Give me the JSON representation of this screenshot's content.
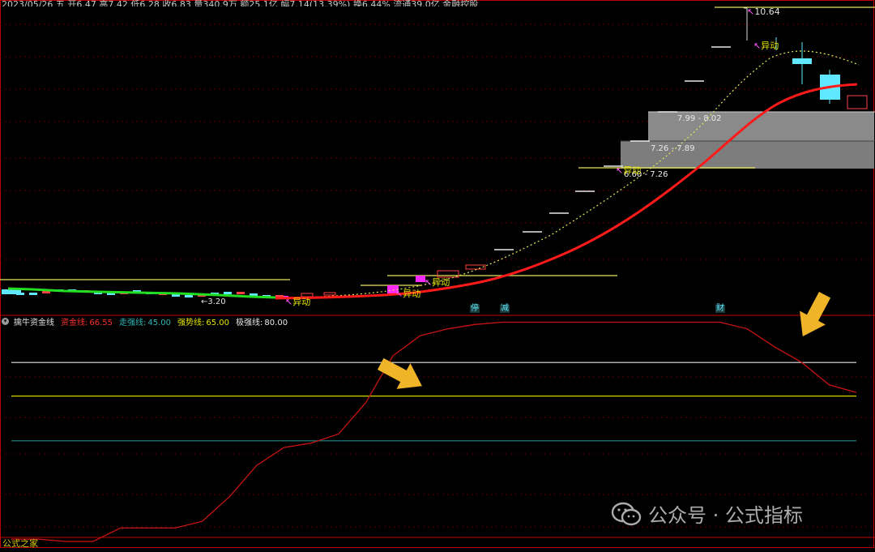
{
  "header": {
    "summary": "2023/05/26 五 开6.47 高7.42 低6.28 收6.83 量340.9万 额25.1亿 幅7.14(13.39%) 换6.44% 流通39.0亿 金融控股"
  },
  "colors": {
    "background": "#000000",
    "frame": "#c00000",
    "ma_red": "#ff1a1a",
    "ma_yellow": "#e6e65a",
    "zone_gray": "#8a8a8a",
    "candle_cyan": "#5fe8ff",
    "candle_magenta": "#ff2aff",
    "indicator_red": "#c81414",
    "line_white": "#e8e8e8",
    "line_yellow": "#d4d400",
    "line_teal": "#1f8a8a",
    "arrow": "#f0b428",
    "green": "#22dd22"
  },
  "main_chart": {
    "price_labels": {
      "high": "10.64",
      "low": "3.20"
    },
    "zones": [
      {
        "label": "7.99 - 8.02"
      },
      {
        "label": "7.26 - 7.89"
      },
      {
        "label": "6.60 - 7.26"
      }
    ],
    "signals": [
      "异动",
      "异动",
      "异动",
      "异动",
      "异动"
    ],
    "markers": [
      "停",
      "减",
      "财"
    ]
  },
  "indicator": {
    "title": "擒牛资金线",
    "legend": [
      {
        "name": "资金线:",
        "value": "66.55",
        "color": "#ff3030"
      },
      {
        "name": "走强线:",
        "value": "45.00",
        "color": "#2fb5b5"
      },
      {
        "name": "强势线:",
        "value": "65.00",
        "color": "#e6e600"
      },
      {
        "name": "极强线:",
        "value": "80.00",
        "color": "#e8e8e8"
      }
    ],
    "levels": {
      "extreme": 80,
      "strong": 65,
      "rising": 45
    },
    "series": [
      1,
      1,
      0,
      0,
      6,
      6,
      6,
      9,
      20,
      34,
      42,
      44,
      48,
      62,
      83,
      92,
      95,
      97,
      98,
      98,
      98,
      98,
      98,
      98,
      98,
      98,
      98,
      95,
      87,
      80,
      70,
      66.55
    ]
  },
  "watermark": {
    "text": "公众号 · 公式指标"
  },
  "brand": "公式之家"
}
